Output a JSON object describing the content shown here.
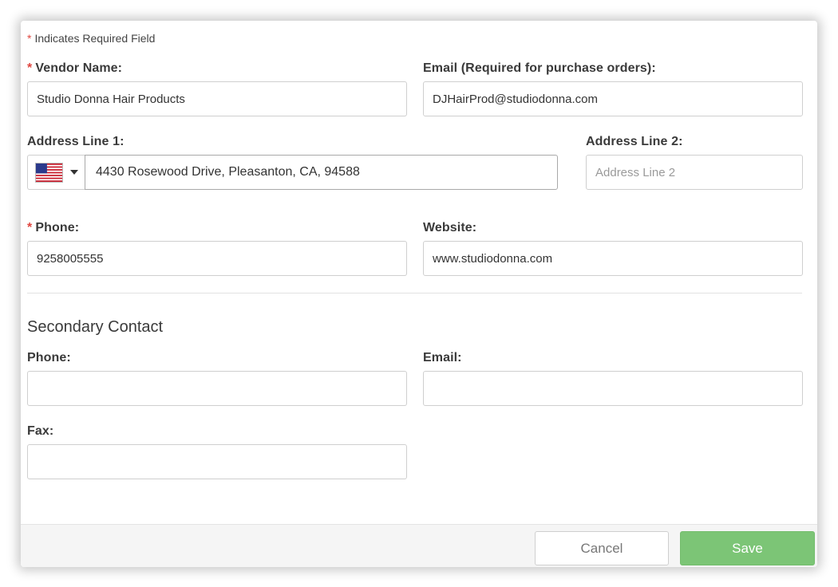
{
  "required_note": {
    "star": "*",
    "text": "Indicates Required Field"
  },
  "vendor_name": {
    "label": "Vendor Name:",
    "required": true,
    "value": "Studio Donna Hair Products"
  },
  "email_primary": {
    "label": "Email (Required for purchase orders):",
    "value": "DJHairProd@studiodonna.com"
  },
  "address_line_1": {
    "label": "Address Line 1:",
    "country_flag": "us-flag-icon",
    "value": "4430 Rosewood Drive, Pleasanton, CA, 94588"
  },
  "address_line_2": {
    "label": "Address Line 2:",
    "value": "",
    "placeholder": "Address Line 2"
  },
  "phone_primary": {
    "label": "Phone:",
    "required": true,
    "value": "9258005555"
  },
  "website": {
    "label": "Website:",
    "value": "www.studiodonna.com"
  },
  "secondary_contact": {
    "title": "Secondary Contact",
    "phone": {
      "label": "Phone:",
      "value": ""
    },
    "email": {
      "label": "Email:",
      "value": ""
    },
    "fax": {
      "label": "Fax:",
      "value": ""
    }
  },
  "footer": {
    "cancel_label": "Cancel",
    "save_label": "Save"
  },
  "colors": {
    "required_star": "#e0463f",
    "save_button": "#7cc576",
    "border": "#cfcfcf"
  }
}
